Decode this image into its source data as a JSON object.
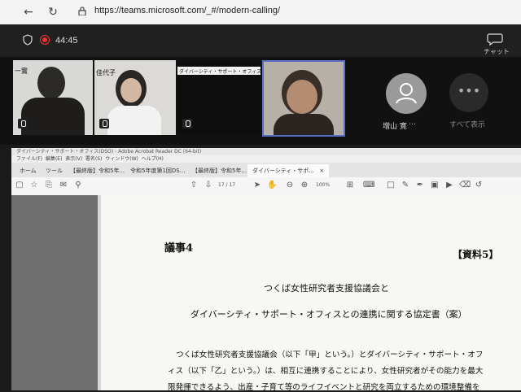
{
  "browser": {
    "url": "https://teams.microsoft.com/_#/modern-calling/"
  },
  "teams": {
    "timer": "44:45",
    "chat_label": "チャット",
    "participants": [
      {
        "name": "一實"
      },
      {
        "name": "佳代子"
      },
      {
        "name": "ダイバーシティ・サポート・オフィス(DSO) 会議・懇談会"
      },
      {
        "name": ""
      }
    ],
    "avatar_name": "増山 寛",
    "more_label": "すべて表示"
  },
  "acrobat": {
    "title": "ダイバーシティ・サポート・オフィス(DSO) - Adobe Acrobat Reader DC (64-bit)",
    "menu": [
      "ファイル(F)",
      "編集(E)",
      "表示(V)",
      "署名(S)",
      "ウィンドウ(W)",
      "ヘルプ(H)"
    ],
    "tabs": [
      "ホーム",
      "ツール",
      "【最終版】令和5年...",
      "令和5年度第1回DS...",
      "【最終版】令和5年...",
      "ダイバーシティ・サポ..."
    ],
    "page_indicator": "17 / 17",
    "zoom": "100%"
  },
  "document": {
    "agenda": "議事4",
    "doc_ref": "【資料5】",
    "title_line1": "つくば女性研究者支援協議会と",
    "title_line2": "ダイバーシティ・サポート・オフィスとの連携に関する協定書（案）",
    "body_lines": [
      "つくば女性研究者支援協議会（以下「甲」という。）とダイバーシティ・サポート・オフ",
      "ィス（以下「乙」という。）は、相互に連携することにより、女性研究者がその能力を最大",
      "限発揮できるよう、出産・子育て等のライフイベントと研究を両立するための環境整備を"
    ]
  }
}
